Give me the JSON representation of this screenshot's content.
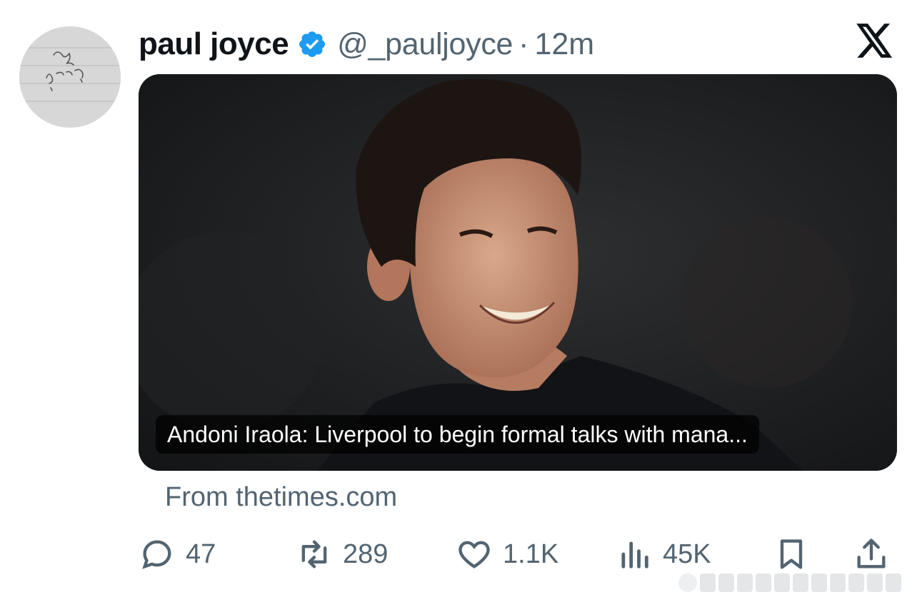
{
  "tweet": {
    "author_name": "paul joyce",
    "handle": "@_pauljoyce",
    "separator": "·",
    "time": "12m",
    "verified_color": "#1d9bf0"
  },
  "card": {
    "caption": "Andoni Iraola: Liverpool to begin formal talks with mana...",
    "source": "From thetimes.com"
  },
  "actions": {
    "replies": "47",
    "reposts": "289",
    "likes": "1.1K",
    "views": "45K"
  },
  "icons": {
    "platform": "x-logo-icon",
    "verified": "verified-badge-icon",
    "reply": "reply-icon",
    "repost": "repost-icon",
    "like": "heart-icon",
    "views": "views-icon",
    "bookmark": "bookmark-icon",
    "share": "share-icon"
  }
}
